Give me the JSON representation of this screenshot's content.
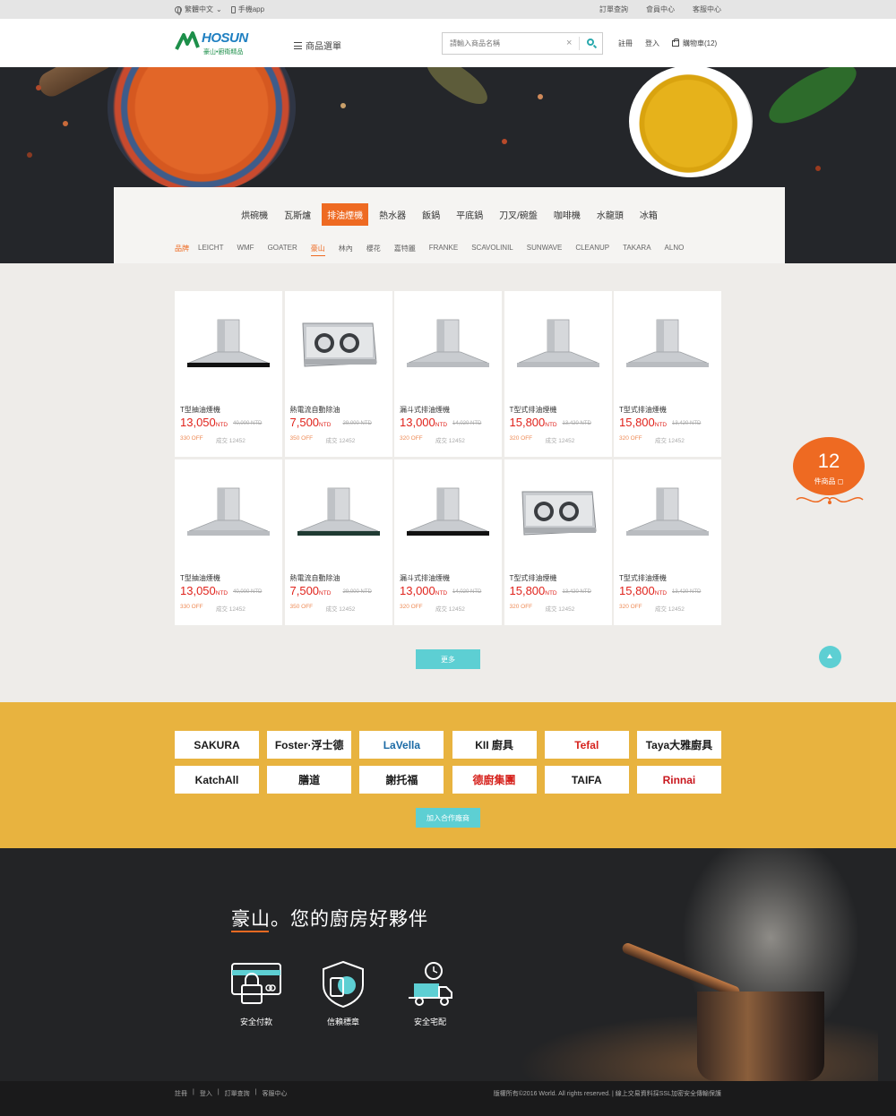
{
  "topbar": {
    "language": "繁體中文",
    "app": "手機app",
    "links": [
      "訂單查詢",
      "會員中心",
      "客服中心"
    ]
  },
  "header": {
    "logo_en": "HOSUN",
    "logo_zh": "豪山•廚衛精品",
    "menu_label": "商品選單",
    "search_placeholder": "請輸入商品名稱",
    "register": "註冊",
    "login": "登入",
    "cart": "購物車(12)"
  },
  "categories": [
    "烘碗機",
    "瓦斯爐",
    "排油煙機",
    "熱水器",
    "飯鍋",
    "平底鍋",
    "刀叉/碗盤",
    "咖啡機",
    "水龍頭",
    "冰箱"
  ],
  "active_category_index": 2,
  "brands_label": "品牌",
  "brands": [
    "LEICHT",
    "WMF",
    "GOATER",
    "豪山",
    "林內",
    "櫻花",
    "嘉特麗",
    "FRANKE",
    "SCAVOLINIL",
    "SUNWAVE",
    "CLEANUP",
    "TAKARA",
    "ALNO"
  ],
  "active_brand_index": 3,
  "products": [
    {
      "name": "T型抽油煙機",
      "price": "13,050",
      "unit": "NTD",
      "original": "40,000 NTD",
      "off": "330 OFF",
      "sold": "成交 12452",
      "img": "t-hood-black"
    },
    {
      "name": "熱電流自動除油",
      "price": "7,500",
      "unit": "NTD",
      "original": "29,000 NTD",
      "off": "350 OFF",
      "sold": "成交 12452",
      "img": "twin-fan"
    },
    {
      "name": "漏斗式排油煙機",
      "price": "13,000",
      "unit": "NTD",
      "original": "14,020 NTD",
      "off": "320 OFF",
      "sold": "成交 12452",
      "img": "t-hood"
    },
    {
      "name": "T型式排油煙機",
      "price": "15,800",
      "unit": "NTD",
      "original": "13,420 NTD",
      "off": "320 OFF",
      "sold": "成交 12452",
      "img": "t-hood"
    },
    {
      "name": "T型式排油煙機",
      "price": "15,800",
      "unit": "NTD",
      "original": "13,420 NTD",
      "off": "320 OFF",
      "sold": "成交 12452",
      "img": "t-hood"
    },
    {
      "name": "T型抽油煙機",
      "price": "13,050",
      "unit": "NTD",
      "original": "40,000 NTD",
      "off": "330 OFF",
      "sold": "成交 12452",
      "img": "t-hood"
    },
    {
      "name": "熱電流自動除油",
      "price": "7,500",
      "unit": "NTD",
      "original": "29,000 NTD",
      "off": "350 OFF",
      "sold": "成交 12452",
      "img": "t-hood-green"
    },
    {
      "name": "漏斗式排油煙機",
      "price": "13,000",
      "unit": "NTD",
      "original": "14,020 NTD",
      "off": "320 OFF",
      "sold": "成交 12452",
      "img": "t-hood-black"
    },
    {
      "name": "T型式排油煙機",
      "price": "15,800",
      "unit": "NTD",
      "original": "13,420 NTD",
      "off": "320 OFF",
      "sold": "成交 12452",
      "img": "twin-fan"
    },
    {
      "name": "T型式排油煙機",
      "price": "15,800",
      "unit": "NTD",
      "original": "13,420 NTD",
      "off": "320 OFF",
      "sold": "成交 12452",
      "img": "t-hood"
    }
  ],
  "more_label": "更多",
  "cart_badge": {
    "count": "12",
    "label": "件商品"
  },
  "partners": [
    {
      "name": "SAKURA",
      "color": "#1a1a1a"
    },
    {
      "name": "Foster·浮士德",
      "color": "#1a1a1a"
    },
    {
      "name": "LaVella",
      "color": "#1b6aa5"
    },
    {
      "name": "KII 廚具",
      "color": "#1a1a1a"
    },
    {
      "name": "Tefal",
      "color": "#d6231e"
    },
    {
      "name": "Taya大雅廚具",
      "color": "#1a1a1a"
    },
    {
      "name": "KatchAll",
      "color": "#1a1a1a"
    },
    {
      "name": "膳道",
      "color": "#1a1a1a"
    },
    {
      "name": "謝托福",
      "color": "#1a1a1a"
    },
    {
      "name": "德廚集團",
      "color": "#d6231e"
    },
    {
      "name": "TAIFA",
      "color": "#1a1a1a"
    },
    {
      "name": "Rinnai",
      "color": "#c8161d"
    }
  ],
  "join_label": "加入合作廠商",
  "slogan": "豪山。您的廚房好夥伴",
  "features": [
    "安全付款",
    "信賴標章",
    "安全宅配"
  ],
  "footer": {
    "links": [
      "註冊",
      "登入",
      "訂單查詢",
      "客服中心"
    ],
    "copyright": "版權所有©2016 World. All rights reserved. | 線上交易資料採SSL加密安全傳輸保護"
  },
  "colors": {
    "accent": "#ee6a22",
    "teal": "#5dcfd3",
    "partner_band": "#e8b33f",
    "price": "#e0231c"
  }
}
